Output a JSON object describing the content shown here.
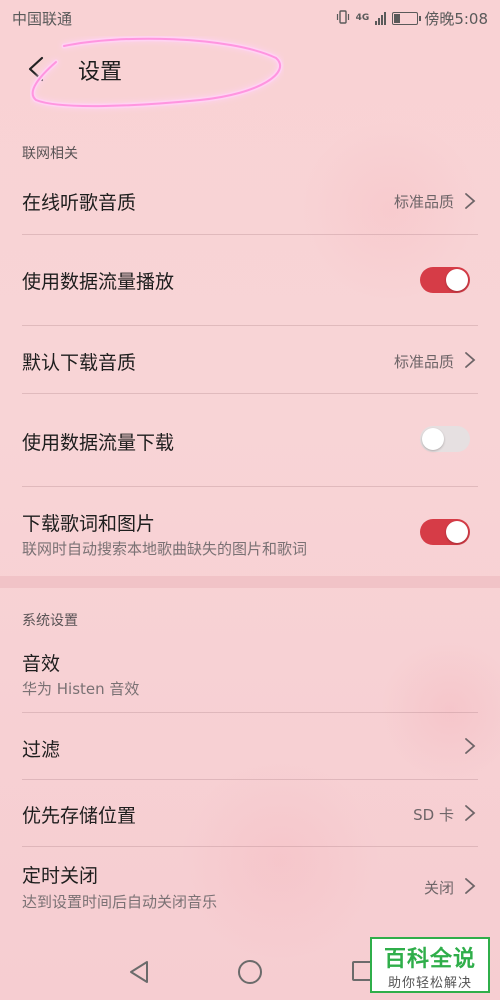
{
  "status_bar": {
    "carrier": "中国联通",
    "network": "4G",
    "time": "傍晚5:08",
    "battery_level": 0.25
  },
  "header": {
    "title": "设置",
    "back_icon": "arrow-left-icon"
  },
  "sections": [
    {
      "header": "联网相关",
      "items": [
        {
          "label": "在线听歌音质",
          "value": "标准品质",
          "type": "chevron"
        },
        {
          "label": "使用数据流量播放",
          "type": "toggle",
          "on": true
        },
        {
          "label": "默认下载音质",
          "value": "标准品质",
          "type": "chevron"
        },
        {
          "label": "使用数据流量下载",
          "type": "toggle",
          "on": false
        },
        {
          "label": "下载歌词和图片",
          "sublabel": "联网时自动搜索本地歌曲缺失的图片和歌词",
          "type": "toggle",
          "on": true
        }
      ]
    },
    {
      "header": "系统设置",
      "items": [
        {
          "label": "音效",
          "sublabel": "华为 Histen 音效",
          "type": "plain"
        },
        {
          "label": "过滤",
          "type": "chevron"
        },
        {
          "label": "优先存储位置",
          "value": "SD 卡",
          "type": "chevron"
        },
        {
          "label": "定时关闭",
          "sublabel": "达到设置时间后自动关闭音乐",
          "value": "关闭",
          "type": "chevron"
        }
      ]
    }
  ],
  "watermark": {
    "main": "百科全说",
    "sub": "助你轻松解决"
  },
  "colors": {
    "accent": "#d63c47",
    "background": "#f9d2d4",
    "watermark_green": "#2fae4a",
    "highlight": "#ff7ad9"
  }
}
